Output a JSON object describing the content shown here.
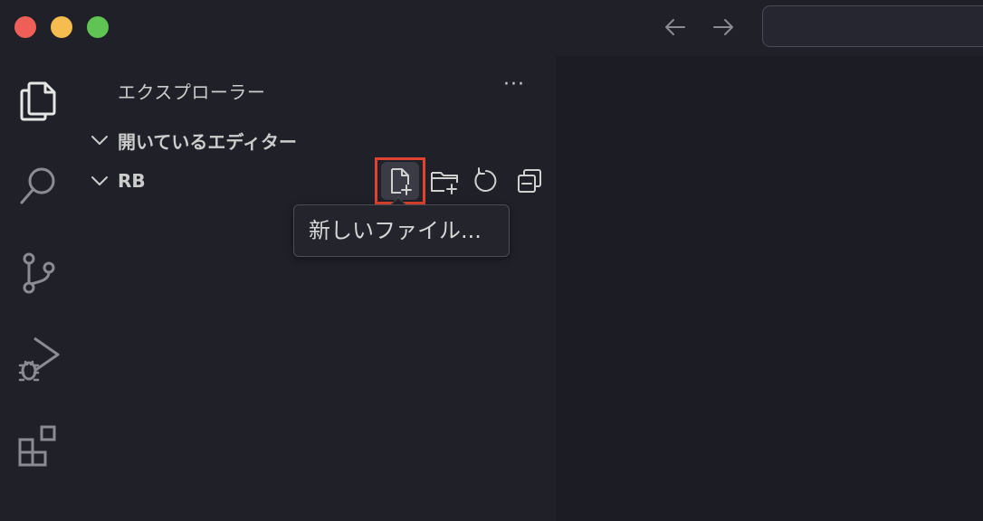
{
  "window": {
    "traffic_lights": [
      "close",
      "minimize",
      "maximize"
    ],
    "colors": {
      "close": "#ee5f58",
      "minimize": "#f5bd4f",
      "maximize": "#5fc454"
    }
  },
  "navigation": {
    "back_icon": "arrow-left-icon",
    "forward_icon": "arrow-right-icon"
  },
  "activity_bar": {
    "items": [
      {
        "id": "explorer",
        "icon": "files-icon",
        "active": true
      },
      {
        "id": "search",
        "icon": "search-icon"
      },
      {
        "id": "source-control",
        "icon": "source-control-icon"
      },
      {
        "id": "run-debug",
        "icon": "run-debug-icon"
      },
      {
        "id": "extensions",
        "icon": "extensions-icon"
      }
    ]
  },
  "sidebar": {
    "title": "エクスプローラー",
    "more_label": "···",
    "sections": [
      {
        "label": "開いているエディター",
        "expanded": true
      },
      {
        "label": "RB",
        "expanded": true
      }
    ],
    "toolbar": [
      {
        "id": "new-file",
        "icon": "new-file-icon",
        "highlighted": true
      },
      {
        "id": "new-folder",
        "icon": "new-folder-icon"
      },
      {
        "id": "refresh",
        "icon": "refresh-icon"
      },
      {
        "id": "collapse-all",
        "icon": "collapse-all-icon"
      }
    ]
  },
  "tooltip": {
    "text": "新しいファイル..."
  },
  "theme": {
    "background": "#1f2028",
    "editor_background": "#1c1d24",
    "highlight_border": "#e0432f",
    "foreground": "#cccccc"
  }
}
